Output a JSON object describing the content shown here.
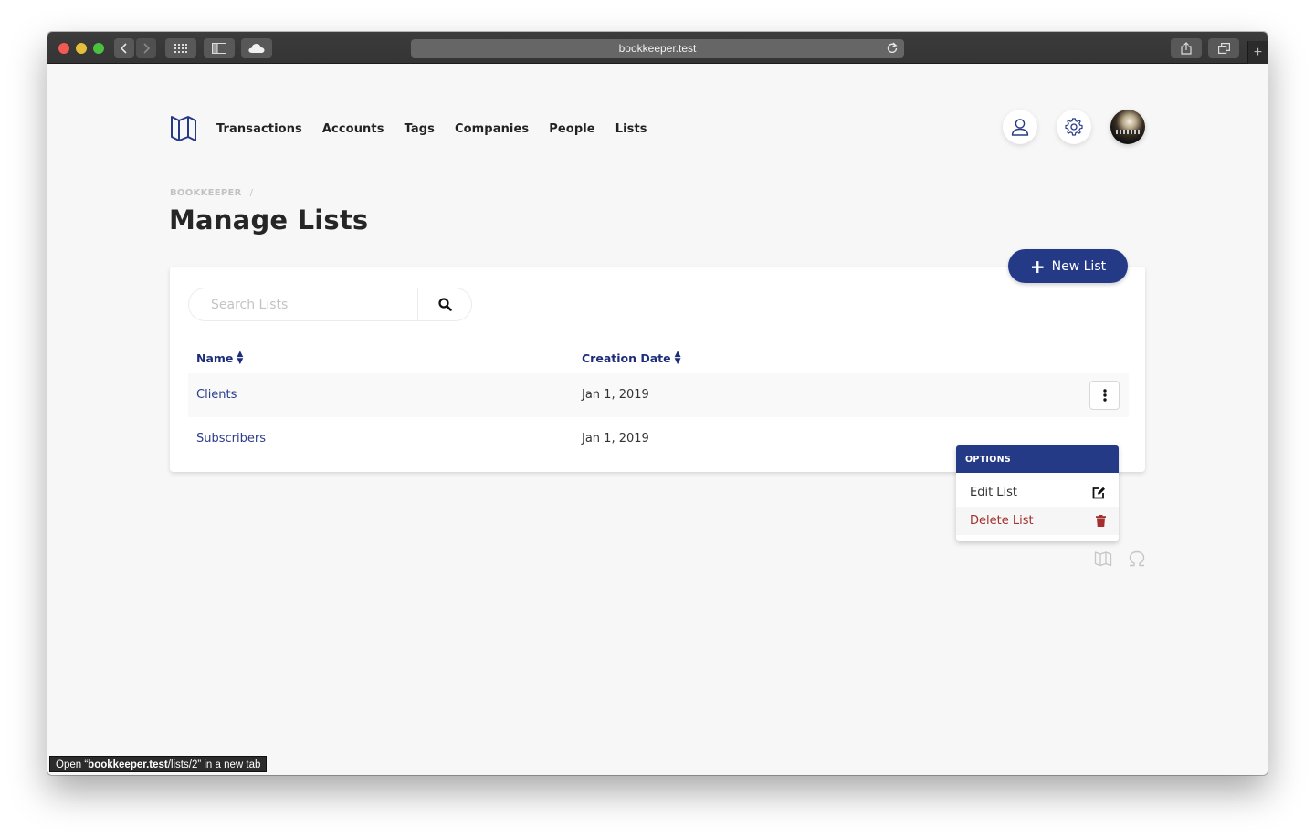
{
  "browser": {
    "url": "bookkeeper.test",
    "status_bar": {
      "prefix": "Open “",
      "host": "bookkeeper.test",
      "path": "/lists/2",
      "suffix": "” in a new tab"
    }
  },
  "nav": {
    "logo": "map-icon",
    "items": [
      {
        "label": "Transactions"
      },
      {
        "label": "Accounts"
      },
      {
        "label": "Tags"
      },
      {
        "label": "Companies"
      },
      {
        "label": "People"
      },
      {
        "label": "Lists"
      }
    ],
    "actions": [
      "user-icon",
      "gear-icon",
      "avatar"
    ]
  },
  "breadcrumb": {
    "root": "BOOKKEEPER",
    "separator": "/"
  },
  "page": {
    "title": "Manage Lists",
    "new_button_label": "New List"
  },
  "search": {
    "placeholder": "Search Lists",
    "value": ""
  },
  "table": {
    "columns": [
      {
        "label": "Name",
        "sortable": true
      },
      {
        "label": "Creation Date",
        "sortable": true
      }
    ],
    "rows": [
      {
        "name": "Clients",
        "date": "Jan 1, 2019"
      },
      {
        "name": "Subscribers",
        "date": "Jan 1, 2019"
      }
    ]
  },
  "options_menu": {
    "header": "OPTIONS",
    "items": [
      {
        "label": "Edit List",
        "icon": "edit-icon"
      },
      {
        "label": "Delete List",
        "icon": "trash-icon"
      }
    ]
  },
  "colors": {
    "brand": "#253a87",
    "link": "#2c3d8c",
    "danger": "#a3302e",
    "background": "#f7f7f7"
  }
}
